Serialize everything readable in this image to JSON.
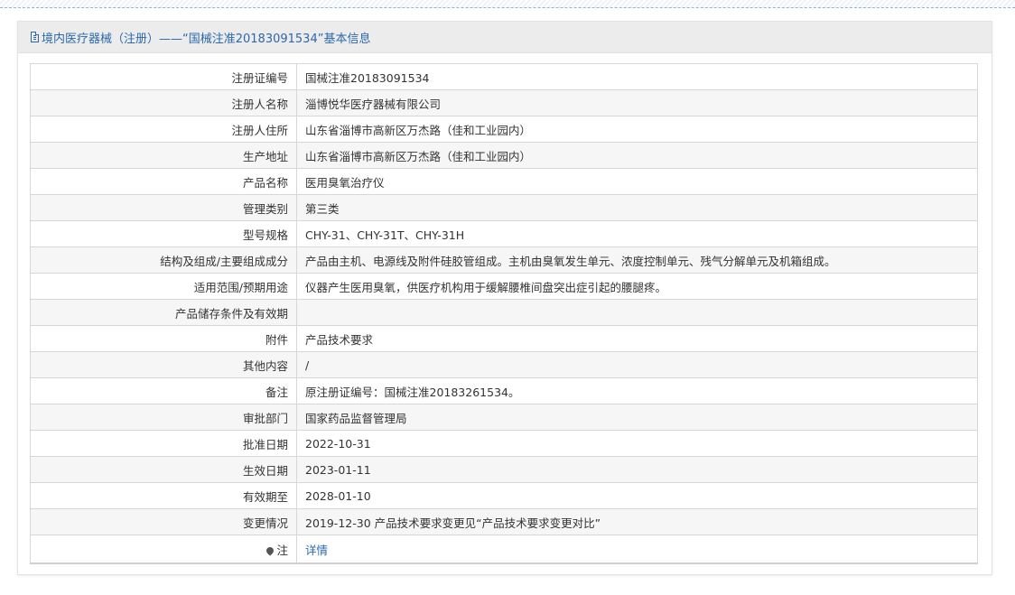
{
  "header": {
    "icon": "document-icon",
    "title": "境内医疗器械（注册）——“国械注准20183091534”基本信息"
  },
  "rows": [
    {
      "label": "注册证编号",
      "value": "国械注准20183091534"
    },
    {
      "label": "注册人名称",
      "value": "淄博悦华医疗器械有限公司"
    },
    {
      "label": "注册人住所",
      "value": "山东省淄博市高新区万杰路（佳和工业园内）"
    },
    {
      "label": "生产地址",
      "value": "山东省淄博市高新区万杰路（佳和工业园内）"
    },
    {
      "label": "产品名称",
      "value": "医用臭氧治疗仪"
    },
    {
      "label": "管理类别",
      "value": "第三类"
    },
    {
      "label": "型号规格",
      "value": "CHY-31、CHY-31T、CHY-31H"
    },
    {
      "label": "结构及组成/主要组成成分",
      "value": "产品由主机、电源线及附件硅胶管组成。主机由臭氧发生单元、浓度控制单元、残气分解单元及机箱组成。"
    },
    {
      "label": "适用范围/预期用途",
      "value": "仪器产生医用臭氧，供医疗机构用于缓解腰椎间盘突出症引起的腰腿疼。"
    },
    {
      "label": "产品储存条件及有效期",
      "value": ""
    },
    {
      "label": "附件",
      "value": "产品技术要求"
    },
    {
      "label": "其他内容",
      "value": "/"
    },
    {
      "label": "备注",
      "value": "原注册证编号：国械注准20183261534。"
    },
    {
      "label": "审批部门",
      "value": "国家药品监督管理局"
    },
    {
      "label": "批准日期",
      "value": "2022-10-31"
    },
    {
      "label": "生效日期",
      "value": "2023-01-11"
    },
    {
      "label": "有效期至",
      "value": "2028-01-10"
    },
    {
      "label": "变更情况",
      "value": "2019-12-30 产品技术要求变更见“产品技术要求变更对比”"
    }
  ],
  "note_row": {
    "icon": "map-marker-icon",
    "label": "注",
    "link": "详情"
  }
}
